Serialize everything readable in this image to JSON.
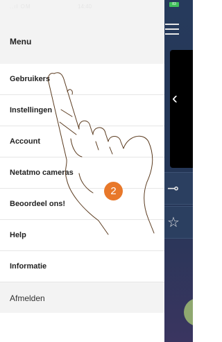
{
  "statusbar": {
    "signal": "..ıl OM",
    "time": "14:40"
  },
  "menu": {
    "title": "Menu",
    "items": [
      {
        "label": "Gebruikers"
      },
      {
        "label": "Instellingen"
      },
      {
        "label": "Account"
      },
      {
        "label": "Netatmo cameras"
      },
      {
        "label": "Beoordeel ons!"
      },
      {
        "label": "Help"
      },
      {
        "label": "Informatie"
      }
    ],
    "logout": "Afmelden"
  },
  "app": {
    "battery": "83",
    "hamburger_icon": "hamburger-icon",
    "back_icon": "chevron-left-icon",
    "key_icon": "key-icon",
    "star_icon": "star-icon"
  },
  "annotation": {
    "step": "2"
  }
}
